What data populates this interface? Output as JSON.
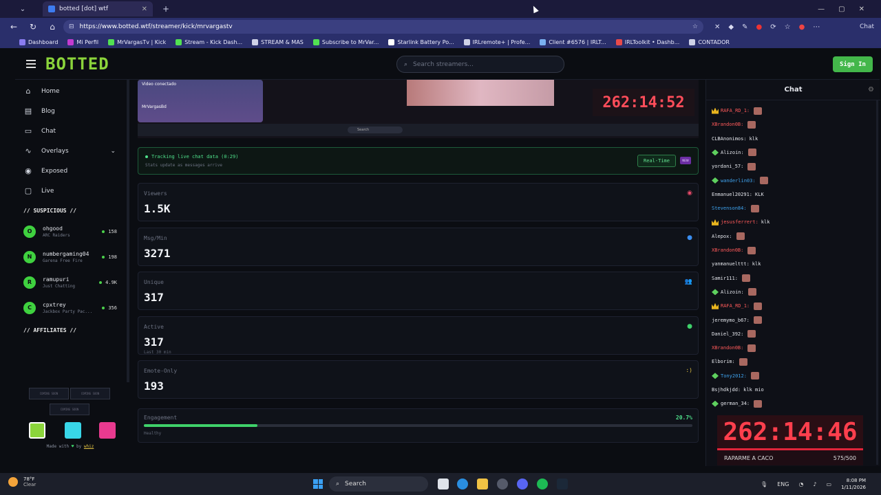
{
  "browser": {
    "tab_title": "botted [dot] wtf",
    "url": "https://www.botted.wtf/streamer/kick/mrvargastv",
    "copilot_label": "Chat",
    "bookmarks": [
      "Dashboard",
      "Mi Perfil",
      "MrVargasTv | Kick",
      "Stream - Kick Dash...",
      "STREAM & MAS",
      "Subscribe to MrVar...",
      "Starlink Battery Po...",
      "IRLremote+ | Profe...",
      "Client #6576 | IRLT...",
      "IRLToolkit • Dashb...",
      "CONTADOR"
    ]
  },
  "header": {
    "logo": "BOTTED",
    "search_placeholder": "Search streamers...",
    "signin_label": "Sign In"
  },
  "sidebar": {
    "nav": [
      {
        "label": "Home",
        "icon": "home-icon"
      },
      {
        "label": "Blog",
        "icon": "document-icon"
      },
      {
        "label": "Chat",
        "icon": "chat-icon"
      },
      {
        "label": "Overlays",
        "icon": "activity-icon"
      },
      {
        "label": "Exposed",
        "icon": "eye-icon"
      },
      {
        "label": "Live",
        "icon": "tv-icon"
      }
    ],
    "suspicious_title": "// SUSPICIOUS //",
    "suspicious": [
      {
        "initial": "O",
        "name": "ohgood",
        "game": "ARC Raiders",
        "count": "158"
      },
      {
        "initial": "N",
        "name": "numbergaming04",
        "game": "Garena Free Fire",
        "count": "198"
      },
      {
        "initial": "R",
        "name": "ramupuri",
        "game": "Just Chatting",
        "count": "4.9K"
      },
      {
        "initial": "C",
        "name": "cpxtrey",
        "game": "Jackbox Party Pac...",
        "count": "356"
      }
    ],
    "affiliates_title": "// AFFILIATES //",
    "affiliate_placeholder": "COMING SOON",
    "theme_colors": [
      "#8bd43b",
      "#38d6e8",
      "#e83a8f"
    ],
    "made_with_prefix": "Made with",
    "made_with_by": "by",
    "made_with_author": "whiz"
  },
  "stream": {
    "timer": "262:14:52",
    "cam_label": "Video conectado",
    "cam_sub": "MrVargasBd",
    "taskbar_search": "Search"
  },
  "tracking": {
    "title": "Tracking live chat data (0:29)",
    "subtitle": "Stats update as messages arrive",
    "realtime_label": "Real-Time",
    "new_badge": "NEW"
  },
  "stats": [
    {
      "label": "Viewers",
      "value": "1.5K",
      "icon": "eye-icon",
      "icon_color": "#e84a6a"
    },
    {
      "label": "Msg/Min",
      "value": "3271",
      "icon": "chat-bubble-icon",
      "icon_color": "#3a8ef0"
    },
    {
      "label": "Unique",
      "value": "317",
      "icon": "users-icon",
      "icon_color": "#9b6ef0"
    },
    {
      "label": "Active",
      "value": "317",
      "sub": "Last 30 min",
      "icon": "check-circle-icon",
      "icon_color": "#3fd16a"
    },
    {
      "label": "Emote-Only",
      "value": "193",
      "icon": "smiley-icon",
      "icon_color": "#e5c543",
      "icon_text": ":)"
    }
  ],
  "engagement": {
    "label": "Engagement",
    "percent_text": "20.7%",
    "percent": 20.7,
    "sub": "Healthy"
  },
  "chat": {
    "title": "Chat",
    "messages": [
      {
        "badge": "crown",
        "user": "RAFA_RD_1:",
        "color": "#ff5a5a",
        "text": "",
        "emote": true
      },
      {
        "badge": "",
        "user": "XBrandon0B:",
        "color": "#ff5a5a",
        "text": "",
        "emote": true
      },
      {
        "badge": "",
        "user": "CLBAnonimos:",
        "color": "#e4e6ec",
        "text": "klk",
        "emote": false
      },
      {
        "badge": "gem",
        "user": "Alizoin:",
        "color": "#e4e6ec",
        "text": "",
        "emote": true
      },
      {
        "badge": "",
        "user": "yordani_57:",
        "color": "#e4e6ec",
        "text": "",
        "emote": true
      },
      {
        "badge": "gem",
        "user": "wanderlin03:",
        "color": "#3fa4f0",
        "text": "",
        "emote": true
      },
      {
        "badge": "",
        "user": "Enmanuel20291:",
        "color": "#e4e6ec",
        "text": "KLK",
        "emote": false
      },
      {
        "badge": "",
        "user": "Stevenson84:",
        "color": "#3fa4f0",
        "text": "",
        "emote": true
      },
      {
        "badge": "crown",
        "user": "jesusferrert:",
        "color": "#ff5a5a",
        "text": "klk",
        "emote": false
      },
      {
        "badge": "",
        "user": "Alepox:",
        "color": "#e4e6ec",
        "text": "",
        "emote": true
      },
      {
        "badge": "",
        "user": "XBrandon0B:",
        "color": "#ff5a5a",
        "text": "",
        "emote": true
      },
      {
        "badge": "",
        "user": "yanmanuelttt:",
        "color": "#e4e6ec",
        "text": "klk",
        "emote": false
      },
      {
        "badge": "",
        "user": "Samir111:",
        "color": "#e4e6ec",
        "text": "",
        "emote": true
      },
      {
        "badge": "gem",
        "user": "Alizoin:",
        "color": "#e4e6ec",
        "text": "",
        "emote": true
      },
      {
        "badge": "crown",
        "user": "RAFA_RD_1:",
        "color": "#ff5a5a",
        "text": "",
        "emote": true
      },
      {
        "badge": "",
        "user": "jeremymo_b67:",
        "color": "#e4e6ec",
        "text": "",
        "emote": true
      },
      {
        "badge": "",
        "user": "Daniel_392:",
        "color": "#e4e6ec",
        "text": "",
        "emote": true
      },
      {
        "badge": "",
        "user": "XBrandon0B:",
        "color": "#ff5a5a",
        "text": "",
        "emote": true
      },
      {
        "badge": "",
        "user": "Elborim:",
        "color": "#e4e6ec",
        "text": "",
        "emote": true
      },
      {
        "badge": "gem",
        "user": "Tony2012:",
        "color": "#3fa4f0",
        "text": "",
        "emote": true
      },
      {
        "badge": "",
        "user": "Bsjhdkjdd:",
        "color": "#e4e6ec",
        "text": "klk mio",
        "emote": false
      },
      {
        "badge": "gem",
        "user": "german_34:",
        "color": "#e4e6ec",
        "text": "",
        "emote": true
      }
    ]
  },
  "overlay_timer": {
    "time": "262:14:46",
    "caption": "RAPARME A CACO",
    "count": "575/500"
  },
  "taskbar": {
    "temp": "78°F",
    "weather": "Clear",
    "search": "Search",
    "lang": "ENG",
    "time": "8:08 PM",
    "date": "1/11/2026"
  }
}
